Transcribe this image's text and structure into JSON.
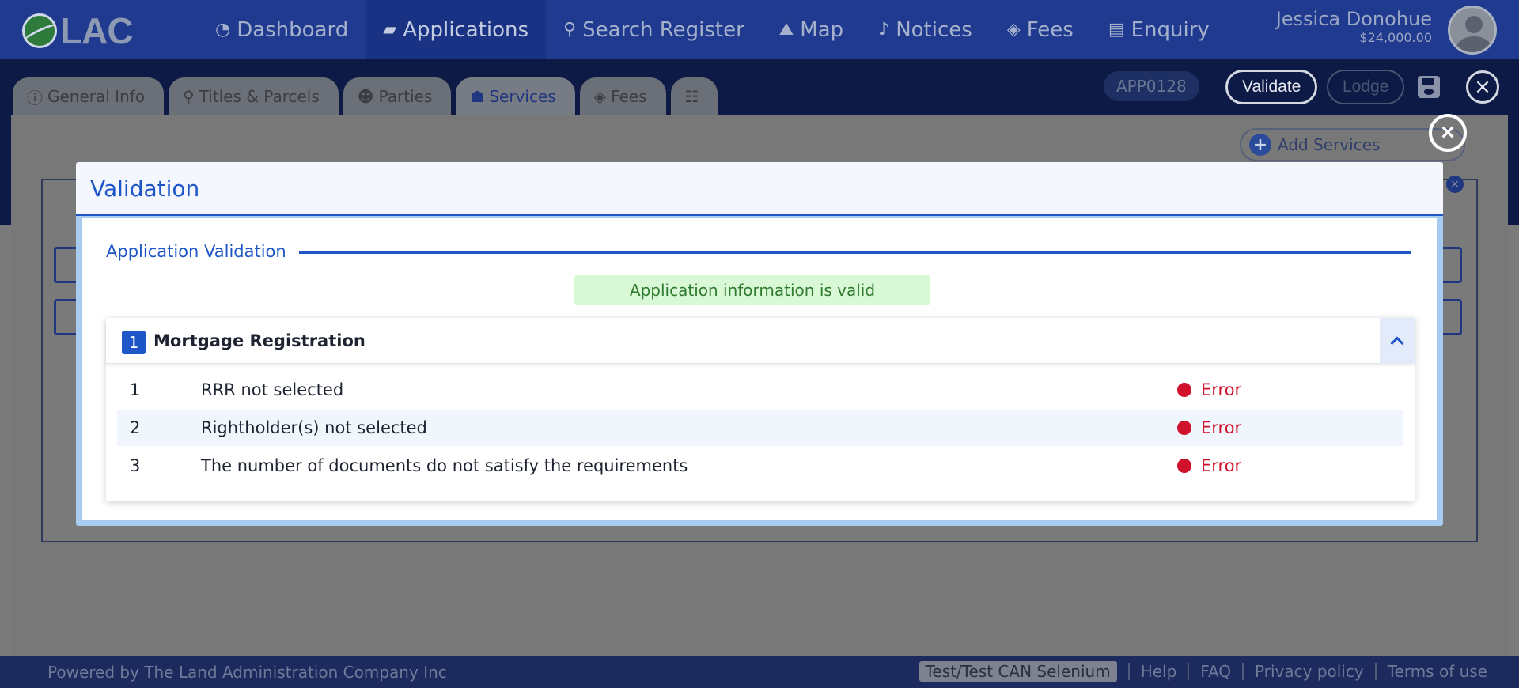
{
  "app": {
    "logo_text": "LAC"
  },
  "nav": {
    "items": [
      {
        "label": "Dashboard",
        "icon": "dashboard-icon"
      },
      {
        "label": "Applications",
        "icon": "folder-icon",
        "active": true
      },
      {
        "label": "Search Register",
        "icon": "search-icon"
      },
      {
        "label": "Map",
        "icon": "map-icon"
      },
      {
        "label": "Notices",
        "icon": "bell-icon"
      },
      {
        "label": "Fees",
        "icon": "tag-icon"
      },
      {
        "label": "Enquiry",
        "icon": "chat-icon"
      }
    ]
  },
  "user": {
    "name": "Jessica Donohue",
    "balance": "$24,000.00"
  },
  "tabs": [
    {
      "label": "General Info",
      "icon": "info-icon"
    },
    {
      "label": "Titles & Parcels",
      "icon": "pin-icon"
    },
    {
      "label": "Parties",
      "icon": "people-icon"
    },
    {
      "label": "Services",
      "icon": "services-icon",
      "active": true
    },
    {
      "label": "Fees",
      "icon": "tag-icon"
    },
    {
      "label": "",
      "icon": "group-icon"
    }
  ],
  "toolbar": {
    "app_number": "APP0128",
    "validate_label": "Validate",
    "lodge_label": "Lodge"
  },
  "services": {
    "add_label": "Add Services"
  },
  "modal": {
    "title": "Validation",
    "section_title": "Application Validation",
    "valid_message": "Application information is valid",
    "service": {
      "number": "1",
      "name": "Mortgage Registration",
      "expanded": true,
      "rows": [
        {
          "num": "1",
          "message": "RRR not selected",
          "status": "Error"
        },
        {
          "num": "2",
          "message": "Rightholder(s) not selected",
          "status": "Error"
        },
        {
          "num": "3",
          "message": "The number of documents do not satisfy the requirements",
          "status": "Error"
        }
      ]
    }
  },
  "footer": {
    "powered_by": "Powered by The Land Administration Company Inc",
    "environment": "Test/Test CAN Selenium",
    "links": [
      "Help",
      "FAQ",
      "Privacy policy",
      "Terms of use"
    ]
  },
  "colors": {
    "nav_bg": "#1f3a8f",
    "accent": "#1e56c8",
    "error": "#d0112b",
    "valid_bg": "#d8f8d6",
    "valid_text": "#2f7a2e"
  }
}
